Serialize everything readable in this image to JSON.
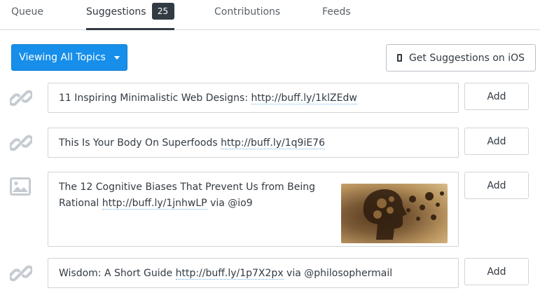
{
  "tabs": [
    {
      "label": "Queue"
    },
    {
      "label": "Suggestions",
      "badge": "25"
    },
    {
      "label": "Contributions"
    },
    {
      "label": "Feeds"
    }
  ],
  "toolbar": {
    "topic_label": "Viewing All Topics",
    "ios_label": "Get Suggestions on iOS"
  },
  "suggestions": [
    {
      "icon": "link-icon",
      "text": "11 Inspiring Minimalistic Web Designs: ",
      "link": "http://buff.ly/1klZEdw",
      "after": "",
      "add": "Add"
    },
    {
      "icon": "link-icon",
      "text": "This Is Your Body On Superfoods ",
      "link": "http://buff.ly/1q9iE76",
      "after": "",
      "add": "Add"
    },
    {
      "icon": "image-icon",
      "text": "The 12 Cognitive Biases That Prevent Us from Being Rational ",
      "link": "http://buff.ly/1jnhwLP",
      "after": " via @io9",
      "add": "Add"
    },
    {
      "icon": "link-icon",
      "text": "Wisdom: A Short Guide ",
      "link": "http://buff.ly/1p7X2px",
      "after": " via @philosophermail",
      "add": "Add"
    }
  ],
  "colors": {
    "accent": "#168eea",
    "badge": "#323b43",
    "icon": "#c5cbd1"
  }
}
